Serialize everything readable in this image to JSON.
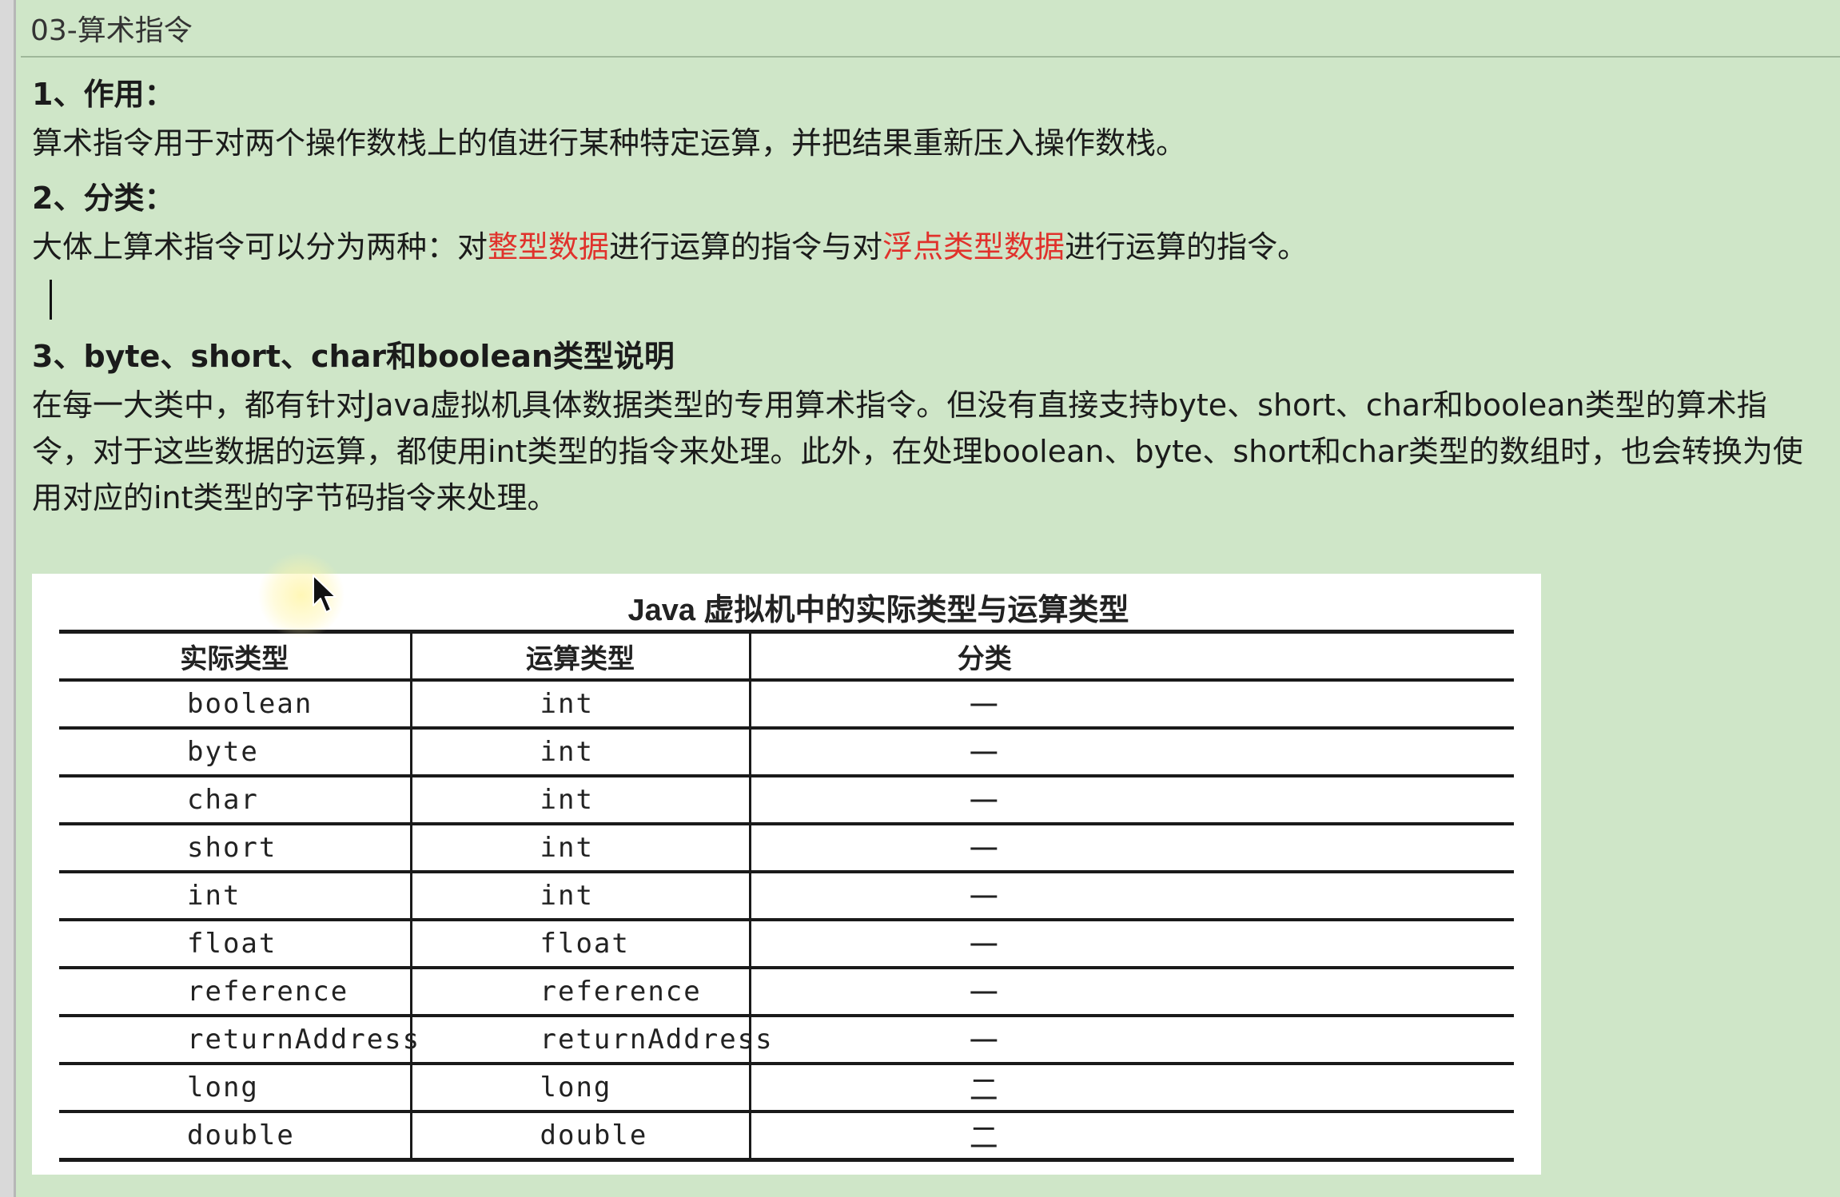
{
  "window": {
    "title": "03-算术指令"
  },
  "section1": {
    "heading": "1、作用：",
    "text": "算术指令用于对两个操作数栈上的值进行某种特定运算，并把结果重新压入操作数栈。"
  },
  "section2": {
    "heading": "2、分类：",
    "text_before": "大体上算术指令可以分为两种：对",
    "highlight1": "整型数据",
    "text_middle": "进行运算的指令与对",
    "highlight2": "浮点类型数据",
    "text_after": "进行运算的指令。",
    "highlight_color": "#e0322c"
  },
  "section3": {
    "heading": "3、byte、short、char和boolean类型说明",
    "paragraph": "在每一大类中，都有针对Java虚拟机具体数据类型的专用算术指令。但没有直接支持byte、short、char和boolean类型的算术指令，对于这些数据的运算，都使用int类型的指令来处理。此外，在处理boolean、byte、short和char类型的数组时，也会转换为使用对应的int类型的字节码指令来处理。"
  },
  "table": {
    "title": "Java 虚拟机中的实际类型与运算类型",
    "headers": [
      "实际类型",
      "运算类型",
      "分类"
    ],
    "rows": [
      [
        "boolean",
        "int",
        "一"
      ],
      [
        "byte",
        "int",
        "一"
      ],
      [
        "char",
        "int",
        "一"
      ],
      [
        "short",
        "int",
        "一"
      ],
      [
        "int",
        "int",
        "一"
      ],
      [
        "float",
        "float",
        "一"
      ],
      [
        "reference",
        "reference",
        "一"
      ],
      [
        "returnAddress",
        "returnAddress",
        "一"
      ],
      [
        "long",
        "long",
        "二"
      ],
      [
        "double",
        "double",
        "二"
      ]
    ]
  },
  "colors": {
    "background": "#cfe6c8",
    "highlight": "#e0322c"
  },
  "icons": {
    "cursor": "mouse-pointer-icon"
  }
}
